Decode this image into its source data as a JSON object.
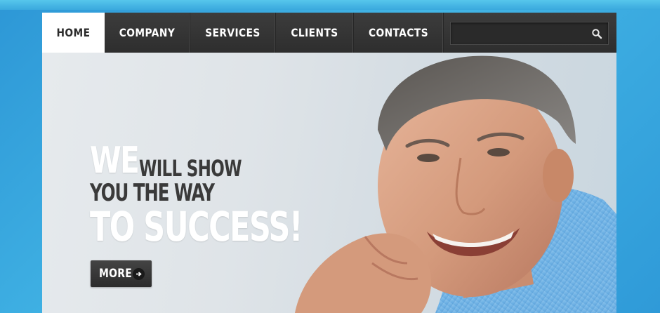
{
  "nav": {
    "items": [
      {
        "label": "HOME",
        "active": true
      },
      {
        "label": "COMPANY",
        "active": false
      },
      {
        "label": "SERVICES",
        "active": false
      },
      {
        "label": "CLIENTS",
        "active": false
      },
      {
        "label": "CONTACTS",
        "active": false
      }
    ]
  },
  "search": {
    "value": "",
    "placeholder": "",
    "icon": "search-icon"
  },
  "hero": {
    "headline": {
      "we": "WE",
      "will_show": "WILL SHOW",
      "you_the_way": "YOU THE WAY",
      "to_success": "TO SUCCESS!"
    },
    "more_button": {
      "label": "MORE",
      "icon": "arrow-right-icon"
    },
    "photo": "smiling-man-photo"
  },
  "colors": {
    "background": "#3aa6dc",
    "navbar": "#333333",
    "active_tab": "#ffffff",
    "headline_dark": "#3a3a3a",
    "headline_light": "#ffffff"
  }
}
